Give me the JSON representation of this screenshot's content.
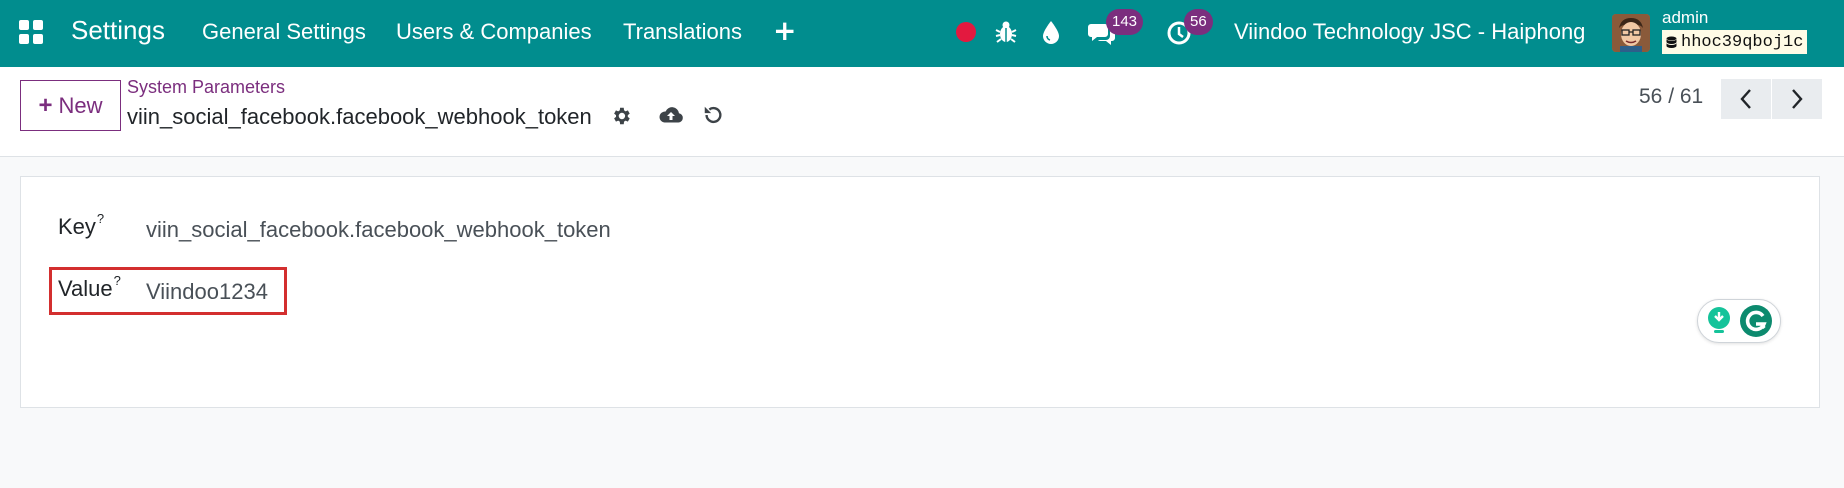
{
  "navbar": {
    "app_name": "Settings",
    "menu": [
      "General Settings",
      "Users & Companies",
      "Translations"
    ],
    "company": "Viindoo Technology JSC - Haiphong",
    "messages_count": "143",
    "activities_count": "56",
    "user": "admin",
    "database": "hhoc39qboj1c",
    "icons": [
      "apps-icon",
      "plus-icon",
      "recording-icon",
      "bug-icon",
      "drop-icon",
      "messages-icon",
      "activity-clock-icon",
      "database-icon"
    ],
    "colors": {
      "bar": "#018d8e",
      "badge": "#7b2e7e",
      "recording": "#e3193f"
    }
  },
  "control_panel": {
    "new_label": "New",
    "breadcrumb": "System Parameters",
    "record_title": "viin_social_facebook.facebook_webhook_token",
    "pager": "56 / 61",
    "icons": [
      "gear-icon",
      "cloud-upload-icon",
      "discard-icon",
      "chevron-left-icon",
      "chevron-right-icon"
    ]
  },
  "form": {
    "key_label": "Key",
    "key_value": "viin_social_facebook.facebook_webhook_token",
    "value_label": "Value",
    "value_value": "Viindoo1234",
    "help_mark": "?",
    "highlight_color": "#d32f2f"
  }
}
